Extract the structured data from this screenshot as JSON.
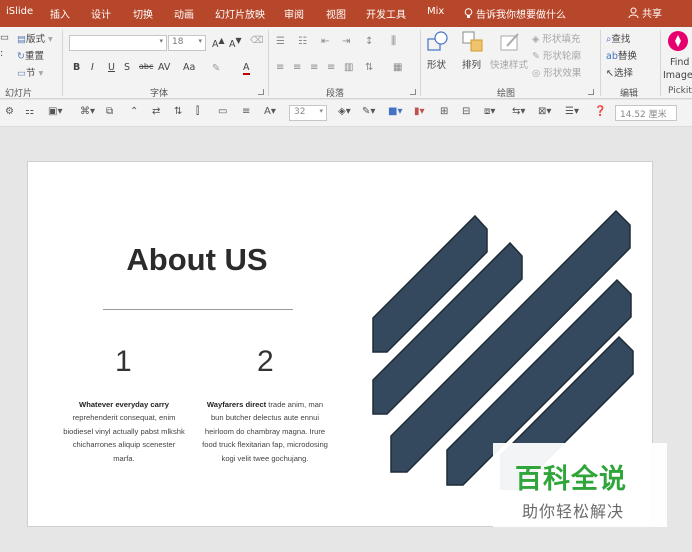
{
  "tabs": [
    "iSlide",
    "插入",
    "设计",
    "切换",
    "动画",
    "幻灯片放映",
    "审阅",
    "视图",
    "开发工具",
    "Mix"
  ],
  "tell_me": "告诉我你想要做什么",
  "share": "共享",
  "ribbon": {
    "slides": {
      "layout": "版式",
      "reset": "重置",
      "section": "节",
      "label": "幻灯片"
    },
    "font": {
      "size": "18",
      "label": "字体",
      "format_buttons": [
        "B",
        "I",
        "U",
        "S",
        "abc",
        "AV",
        "Aa",
        "A"
      ]
    },
    "paragraph": {
      "label": "段落"
    },
    "drawing": {
      "shape": "形状",
      "arrange": "排列",
      "quick_styles": "快速样式",
      "shape_fill": "形状填充",
      "shape_outline": "形状轮廓",
      "shape_effects": "形状效果",
      "label": "绘图"
    },
    "editing": {
      "find": "查找",
      "replace": "替换",
      "select": "选择",
      "label": "编辑"
    },
    "pickit": {
      "find": "Find",
      "image": "Image",
      "label": "Pickit"
    }
  },
  "toolbar2": {
    "font_size": "32",
    "width": "14.52 厘米"
  },
  "slide": {
    "title": "About US",
    "stripe_color": "#34495e",
    "columns": [
      {
        "number": "1",
        "lead": "Whatever everyday carry",
        "body": "reprehenderit consequat, enim biodiesel vinyl actually pabst mlkshk chicharrones aliquip scenester marfa."
      },
      {
        "number": "2",
        "lead": "Wayfarers direct",
        "body": "trade anim, man bun butcher delectus aute ennui heirloom do chambray magna. Irure food truck flexitarian fap, microdosing kogi velit twee gochujang."
      }
    ]
  },
  "watermark": {
    "line1": "百科全说",
    "line2": "助你轻松解决"
  },
  "colors": {
    "accent": "#b7472a",
    "stripe": "#34495e",
    "watermark_green": "#30a63a"
  }
}
